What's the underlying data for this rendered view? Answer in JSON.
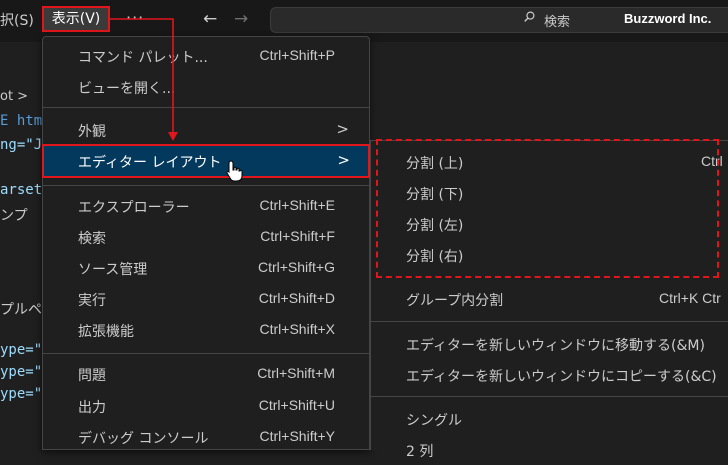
{
  "titlebar": {
    "menu_partial": "択(S)",
    "menu_view": "表示(V)",
    "ellipsis": "···",
    "nav_back": "←",
    "nav_forward": "→",
    "search_label": "検索",
    "brand": "Buzzword Inc."
  },
  "editor_fragments": {
    "breadcrumb": "ot >",
    "line1": "E htm",
    "line2": "ng=\"J",
    "line3": "arset",
    "line4": "ンプ",
    "line5": "プルペ",
    "line6": "ype=\"",
    "line7": "ype=\"",
    "line8": "ype=\""
  },
  "view_menu": {
    "items": [
      {
        "label": "コマンド パレット...",
        "shortcut": "Ctrl+Shift+P"
      },
      {
        "label": "ビューを開く...",
        "shortcut": ""
      },
      {
        "label": "外観",
        "shortcut": ""
      },
      {
        "label": "エディター レイアウト",
        "shortcut": ""
      },
      {
        "label": "エクスプローラー",
        "shortcut": "Ctrl+Shift+E"
      },
      {
        "label": "検索",
        "shortcut": "Ctrl+Shift+F"
      },
      {
        "label": "ソース管理",
        "shortcut": "Ctrl+Shift+G"
      },
      {
        "label": "実行",
        "shortcut": "Ctrl+Shift+D"
      },
      {
        "label": "拡張機能",
        "shortcut": "Ctrl+Shift+X"
      },
      {
        "label": "問題",
        "shortcut": "Ctrl+Shift+M"
      },
      {
        "label": "出力",
        "shortcut": "Ctrl+Shift+U"
      },
      {
        "label": "デバッグ コンソール",
        "shortcut": "Ctrl+Shift+Y"
      }
    ],
    "submenu_arrow": ">"
  },
  "layout_submenu": {
    "items": [
      {
        "label": "分割 (上)",
        "shortcut": "Ctrl"
      },
      {
        "label": "分割 (下)",
        "shortcut": ""
      },
      {
        "label": "分割 (左)",
        "shortcut": ""
      },
      {
        "label": "分割 (右)",
        "shortcut": ""
      },
      {
        "label": "グループ内分割",
        "shortcut": "Ctrl+K Ctr"
      },
      {
        "label": "エディターを新しいウィンドウに移動する(&M)",
        "shortcut": ""
      },
      {
        "label": "エディターを新しいウィンドウにコピーする(&C)",
        "shortcut": ""
      },
      {
        "label": "シングル",
        "shortcut": ""
      },
      {
        "label": "2 列",
        "shortcut": ""
      }
    ]
  },
  "colors": {
    "highlight": "#e0161a",
    "selected_bg": "#04395e",
    "menu_bg": "#1f1f1f"
  }
}
